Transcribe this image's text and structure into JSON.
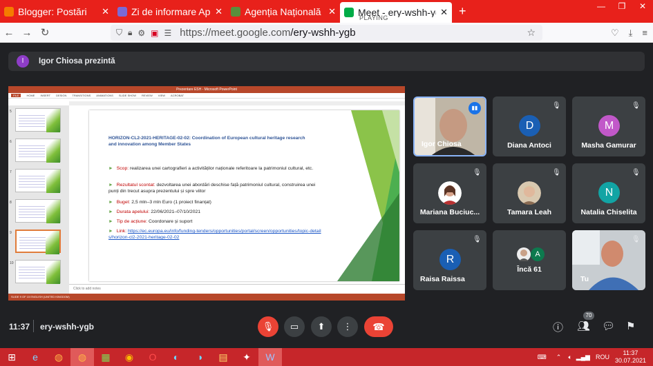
{
  "browser": {
    "tabs": [
      {
        "title": "Blogger: Postări",
        "icon_color": "#f57c00",
        "close": "✕"
      },
      {
        "title": "Zi de informare Ape",
        "icon_color": "#7b6ad6",
        "close": "✕"
      },
      {
        "title": "Agenția Națională p",
        "icon_color": "#5a8f3c",
        "close": "✕"
      },
      {
        "title": "Meet - ery-wshh-yg",
        "subtitle": "PLAYING",
        "icon_color": "#00ac47",
        "close": "✕"
      }
    ],
    "new_tab": "+",
    "url_host": "https://meet.google.com",
    "url_path": "/ery-wshh-ygb"
  },
  "presenter_bar": {
    "avatar": "I",
    "avatar_color": "#8e3dc7",
    "text": "Igor Chiosa prezintă"
  },
  "slide": {
    "title": "HORIZON-CL2-2021-HERITAGE-02-02: Coordination of European cultural heritage research and innovation among Member States",
    "bullets": [
      {
        "key": "Scop:",
        "text": "realizarea unei cartografieri a activităților naționale referitoare la patrimoniul cultural, etc."
      },
      {
        "key": "Rezultatul scontat:",
        "text": "dezvoltarea unei abordări deschise față patrimoniul cultural, construirea unei punți din trecut asupra prezentului și spre viitor"
      },
      {
        "key": "Buget:",
        "text": "2,5 mln–3 mln Euro (1 proiect finanțat)"
      },
      {
        "key": "Durata apelului:",
        "text": "22/06/2021–07/10/2021"
      },
      {
        "key": "Tip de acțiune:",
        "text": "Coordonare și suport"
      },
      {
        "key": "Link:",
        "text": "https://ec.europa.eu/info/funding-tenders/opportunities/portal/screen/opportunities/topic-details/horizon-cl2-2021-heritage-02-02"
      }
    ],
    "notes_placeholder": "Click to add notes",
    "thumb_numbers": [
      "5",
      "6",
      "7",
      "8",
      "9",
      "10"
    ],
    "window_title": "Prezentare ESH - Microsoft PowerPoint",
    "ribbon_tabs": [
      "FILE",
      "HOME",
      "INSERT",
      "DESIGN",
      "TRANSITIONS",
      "ANIMATIONS",
      "SLIDE SHOW",
      "REVIEW",
      "VIEW",
      "ACROBAT"
    ],
    "status_left": "SLIDE 9 OF 15",
    "status_lang": "ENGLISH (UNITED KINGDOM)"
  },
  "participants": [
    {
      "name": "Igor Chiosa",
      "type": "video",
      "speaking": true
    },
    {
      "name": "Diana Antoci",
      "letter": "D",
      "color": "#1a5fb4",
      "muted": true
    },
    {
      "name": "Masha Gamurar",
      "letter": "M",
      "color": "#c158c9",
      "muted": true
    },
    {
      "name": "Mariana Buciuc...",
      "type": "photo",
      "muted": true
    },
    {
      "name": "Tamara Leah",
      "type": "photo",
      "muted": true
    },
    {
      "name": "Natalia Chiselita",
      "letter": "N",
      "color": "#12a4a4",
      "muted": true
    },
    {
      "name": "Raisa Raissa",
      "letter": "R",
      "color": "#1a5fb4",
      "muted": true
    },
    {
      "name": "Încă 61",
      "type": "more",
      "letter": "A"
    },
    {
      "name": "Tu",
      "type": "video",
      "muted": true
    }
  ],
  "controls": {
    "time": "11:37",
    "meeting_code": "ery-wshh-ygb",
    "people_count": "70"
  },
  "taskbar": {
    "lang": "ROU",
    "time": "11:37",
    "date": "30.07.2021"
  }
}
